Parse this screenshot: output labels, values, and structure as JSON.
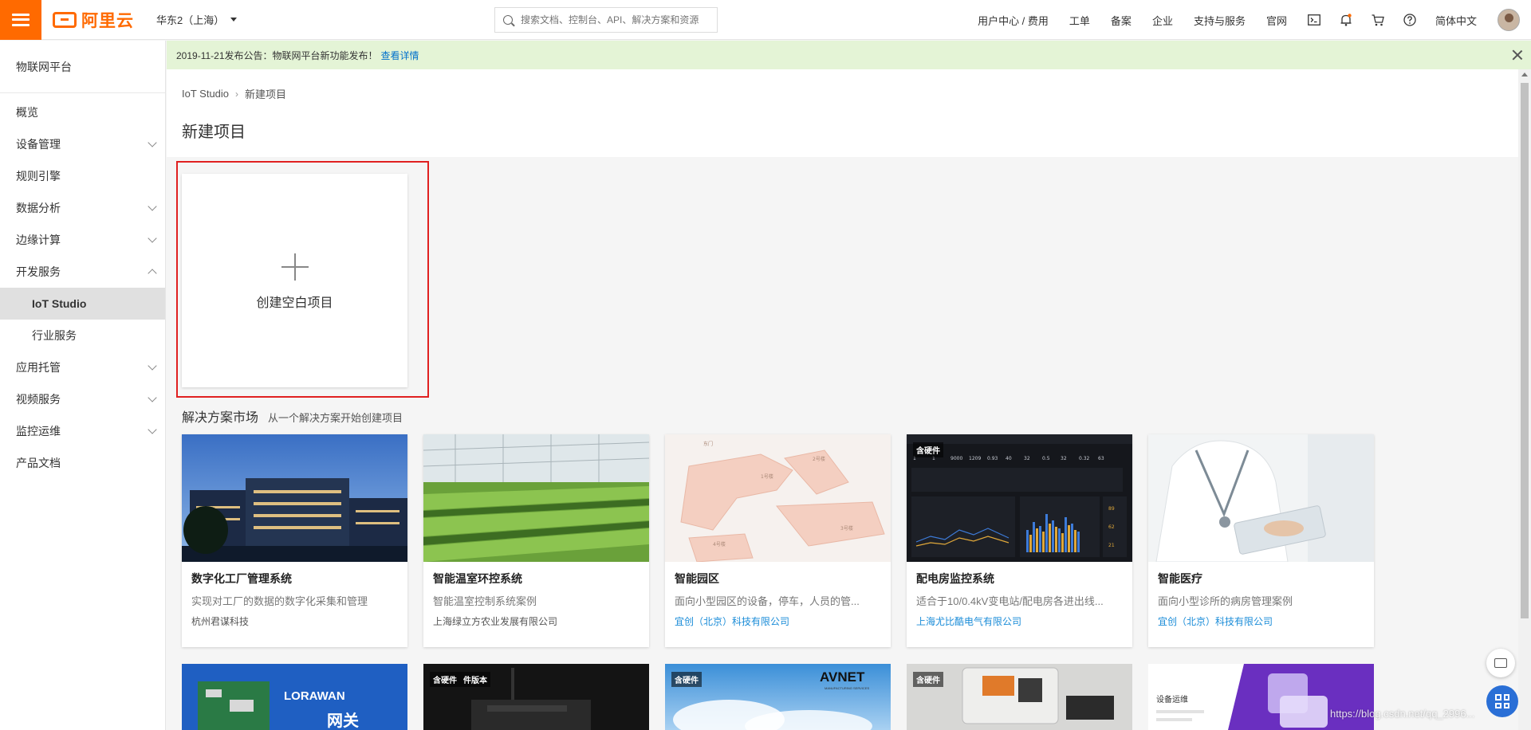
{
  "topbar": {
    "logo_text": "阿里云",
    "region": "华东2（上海）",
    "search_placeholder": "搜索文档、控制台、API、解决方案和资源",
    "nav": [
      "用户中心 / 费用",
      "工单",
      "备案",
      "企业",
      "支持与服务",
      "官网"
    ],
    "language": "简体中文",
    "icons": [
      "terminal-icon",
      "bell-icon",
      "cart-icon",
      "help-icon"
    ]
  },
  "sidebar": {
    "title": "物联网平台",
    "items": [
      {
        "label": "概览"
      },
      {
        "label": "设备管理"
      },
      {
        "label": "规则引擎"
      },
      {
        "label": "数据分析"
      },
      {
        "label": "边缘计算"
      },
      {
        "label": "开发服务"
      },
      {
        "label": "IoT Studio"
      },
      {
        "label": "行业服务"
      },
      {
        "label": "应用托管"
      },
      {
        "label": "视频服务"
      },
      {
        "label": "监控运维"
      },
      {
        "label": "产品文档"
      }
    ]
  },
  "notice": {
    "text": "2019-11-21发布公告：物联网平台新功能发布！",
    "link": "查看详情"
  },
  "breadcrumb": {
    "root": "IoT Studio",
    "sep": "›",
    "current": "新建项目"
  },
  "page_title": "新建项目",
  "create_card": {
    "label": "创建空白项目"
  },
  "market": {
    "title": "解决方案市场",
    "subtitle": "从一个解决方案开始创建项目",
    "cards": [
      {
        "name": "数字化工厂管理系统",
        "desc": "实现对工厂的数据的数字化采集和管理",
        "vendor": "杭州君谋科技"
      },
      {
        "name": "智能温室环控系统",
        "desc": "智能温室控制系统案例",
        "vendor": "上海绿立方农业发展有限公司"
      },
      {
        "name": "智能园区",
        "desc": "面向小型园区的设备，停车，人员的管...",
        "vendor": "宜创（北京）科技有限公司"
      },
      {
        "name": "配电房监控系统",
        "desc": "适合于10/0.4kV变电站/配电房各进出线...",
        "vendor": "上海尤比酷电气有限公司"
      },
      {
        "name": "智能医疗",
        "desc": "面向小型诊所的病房管理案例",
        "vendor": "宜创（北京）科技有限公司"
      }
    ],
    "badge": "含硬件",
    "badge_alt": "件版本",
    "row2_texts": {
      "lorawan": "LORAWAN",
      "gateway": "网关",
      "avnet": "AVNET",
      "avnet_sub": "MANUFACTURING SERVICES",
      "ops": "设备运维"
    },
    "dashboard_text": {
      "labels": [
        "1",
        "1",
        "9000",
        "1209",
        "0.93",
        "40",
        "32",
        "0.5",
        "32",
        "0.32",
        "63"
      ],
      "side": [
        "89",
        "62",
        "21"
      ]
    },
    "map_labels": [
      "东门",
      "2号楼",
      "1号楼",
      "3号楼",
      "4号楼",
      "5号楼"
    ]
  },
  "watermark": "https://blog.csdn.net/qq_2996..."
}
